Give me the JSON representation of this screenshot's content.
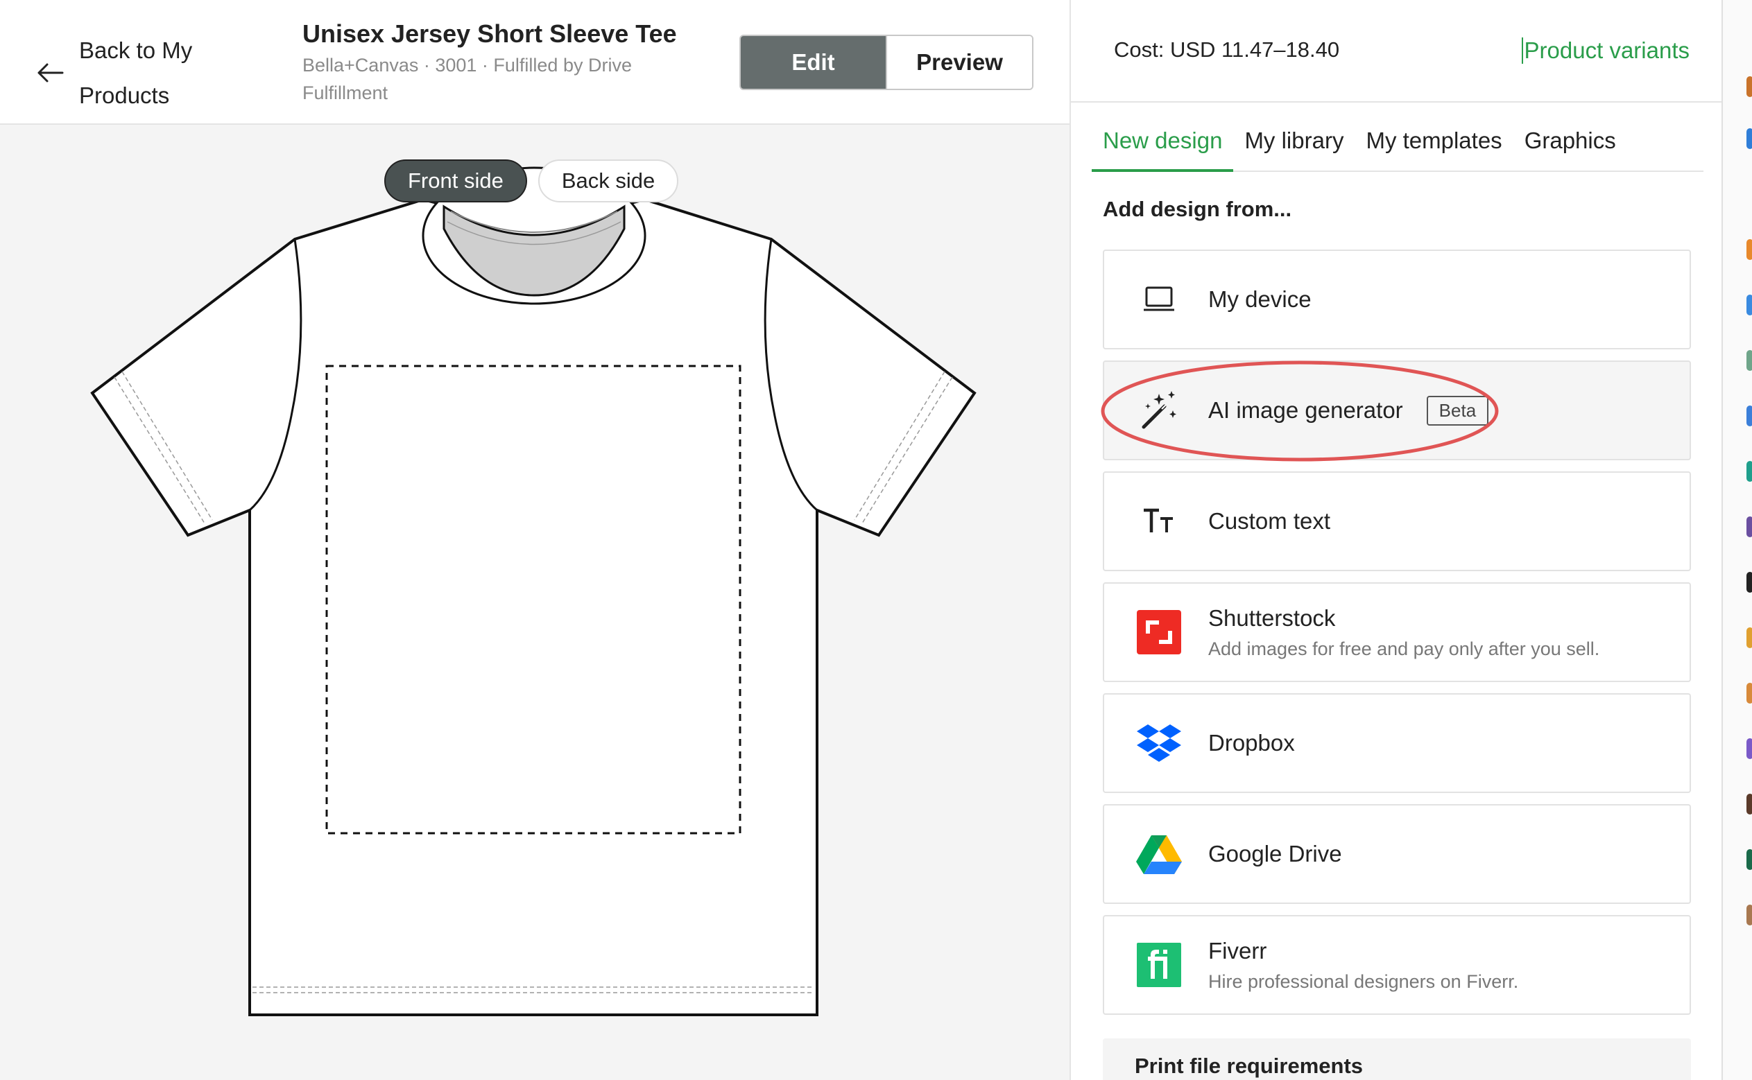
{
  "header": {
    "back_label": "Back to My Products",
    "title": "Unisex Jersey Short Sleeve Tee",
    "subtitle": "Bella+Canvas · 3001 · Fulfilled by Drive Fulfillment",
    "mode_edit": "Edit",
    "mode_preview": "Preview",
    "back_icon": "arrow-left-icon"
  },
  "canvas": {
    "front_label": "Front side",
    "back_label": "Back side",
    "selected_side": "Front side",
    "garment": "t-shirt-front-outline"
  },
  "panel": {
    "cost": "Cost: USD 11.47–18.40",
    "variants_link": "Product variants",
    "tabs": [
      {
        "label": "New design",
        "active": true
      },
      {
        "label": "My library",
        "active": false
      },
      {
        "label": "My templates",
        "active": false
      },
      {
        "label": "Graphics",
        "active": false
      }
    ],
    "section_label": "Add design from...",
    "sources": [
      {
        "title": "My device",
        "desc": "",
        "icon": "laptop-icon"
      },
      {
        "title": "AI image generator",
        "desc": "",
        "icon": "magic-wand-icon",
        "badge": "Beta",
        "annotated": true
      },
      {
        "title": "Custom text",
        "desc": "",
        "icon": "text-size-icon"
      },
      {
        "title": "Shutterstock",
        "desc": "Add images for free and pay only after you sell.",
        "icon": "shutterstock-icon"
      },
      {
        "title": "Dropbox",
        "desc": "",
        "icon": "dropbox-icon"
      },
      {
        "title": "Google Drive",
        "desc": "",
        "icon": "google-drive-icon"
      },
      {
        "title": "Fiverr",
        "desc": "Hire professional designers on Fiverr.",
        "icon": "fiverr-icon"
      }
    ],
    "print_requirements": "Print file requirements"
  },
  "colors": {
    "accent_green": "#2a9d4a",
    "active_toggle": "#656d6d",
    "annotation_red": "#e05555",
    "shutterstock_red": "#ee2b24",
    "dropbox_blue": "#0061fe",
    "fiverr_green": "#1dbf73"
  }
}
